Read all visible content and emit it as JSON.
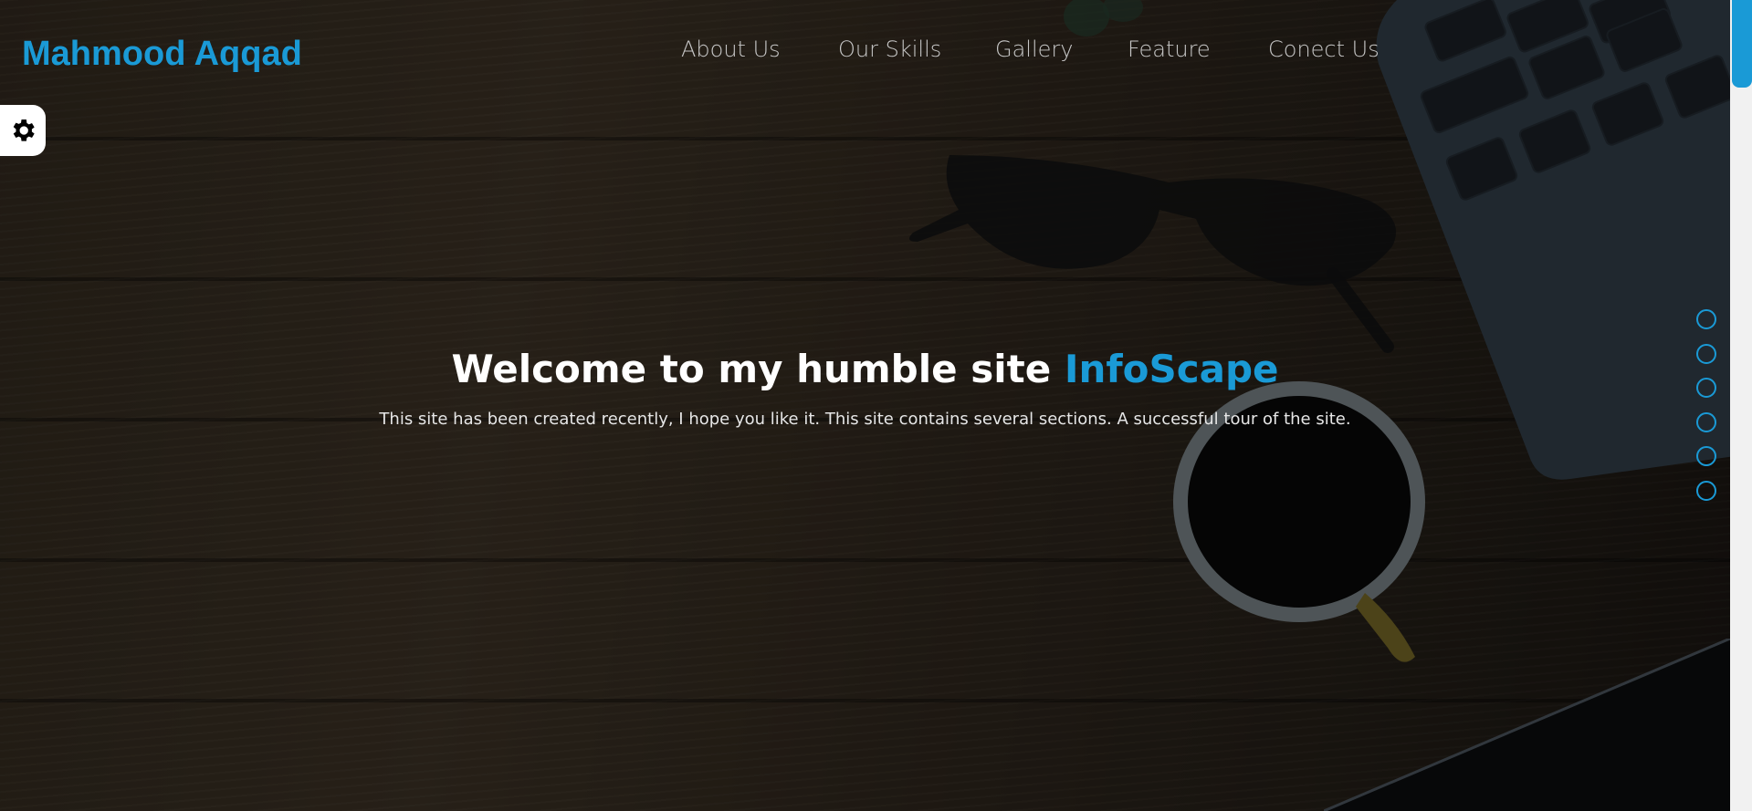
{
  "brand": {
    "name": "Mahmood Aqqad",
    "color": "#1a9ad6"
  },
  "nav": {
    "items": [
      {
        "label": "About Us"
      },
      {
        "label": "Our Skills"
      },
      {
        "label": "Gallery"
      },
      {
        "label": "Feature"
      },
      {
        "label": "Conect Us"
      }
    ]
  },
  "settings": {
    "icon": "gear-icon"
  },
  "hero": {
    "title_prefix": "Welcome to my humble site",
    "title_accent": "InfoScape",
    "subtitle": "This site has been created recently, I hope you like it. This site contains several sections. A successful tour of the site."
  },
  "bullets": {
    "count": 6,
    "color": "#1a9ad6"
  },
  "colors": {
    "accent": "#1a9ad6",
    "nav_text": "#c7c7c7",
    "title": "#ffffff"
  }
}
